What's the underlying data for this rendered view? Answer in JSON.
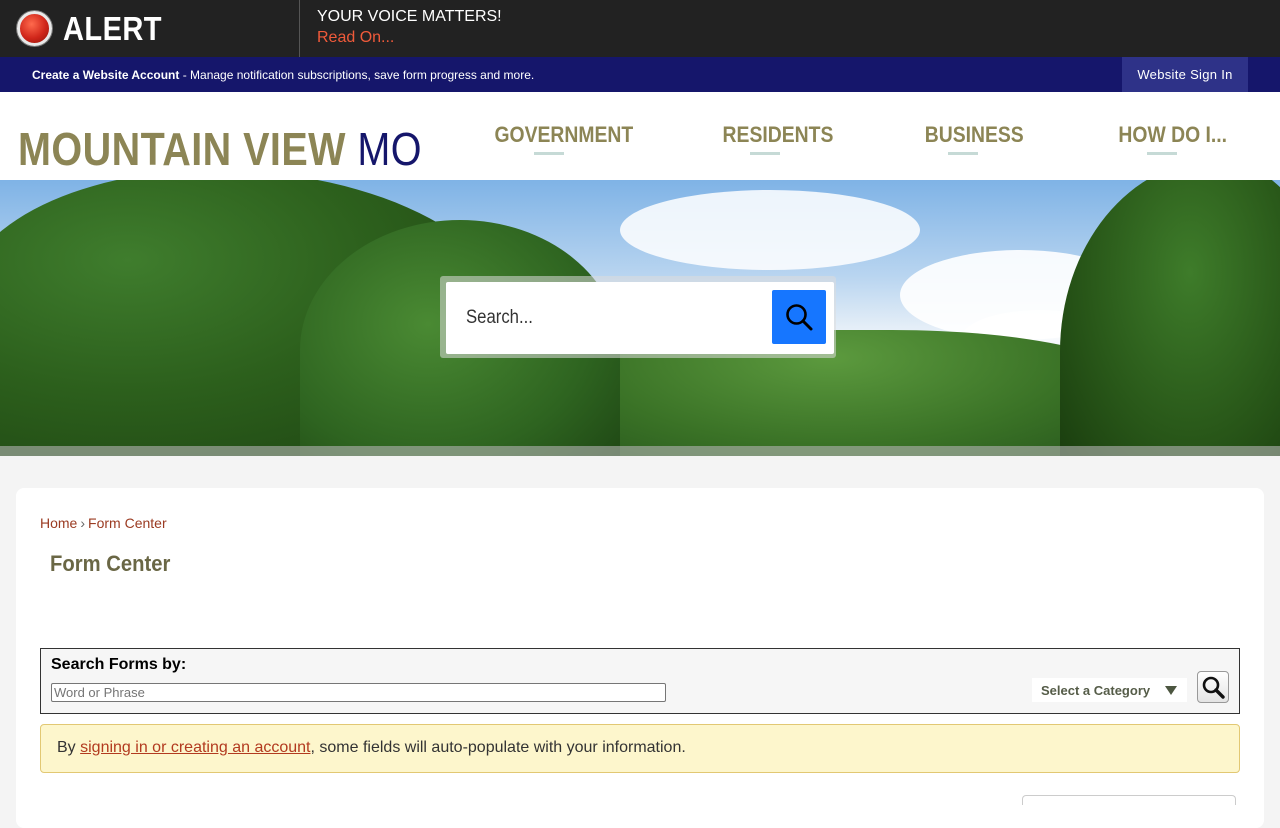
{
  "alert": {
    "label": "ALERT",
    "title": "YOUR VOICE MATTERS!",
    "link": "Read On...",
    "icon": "alert-dot-icon"
  },
  "account_bar": {
    "create_link": "Create a Website Account",
    "description": " - Manage notification subscriptions, save form progress and more.",
    "sign_in": "Website Sign In"
  },
  "header": {
    "logo_main": "MOUNTAIN VIEW",
    "logo_suffix": "MO",
    "nav": [
      "GOVERNMENT",
      "RESIDENTS",
      "BUSINESS",
      "HOW DO I..."
    ]
  },
  "hero_search": {
    "placeholder": "Search...",
    "icon": "search-icon"
  },
  "breadcrumb": {
    "home": "Home",
    "separator": "›",
    "current": "Form Center"
  },
  "page_title": "Form Center",
  "search_forms": {
    "label": "Search Forms by:",
    "placeholder": "Word or Phrase",
    "category": "Select a Category",
    "icon": "search-icon"
  },
  "info": {
    "prefix": "By ",
    "link": "signing in or creating an account",
    "suffix": ", some fields will auto-populate with your information."
  },
  "colors": {
    "alert_bg": "#222222",
    "account_bar_bg": "#15166b",
    "nav_gold": "#8c8555",
    "search_blue": "#1676ff",
    "link_red": "#b23a1f",
    "info_bg": "#fdf6cc"
  }
}
